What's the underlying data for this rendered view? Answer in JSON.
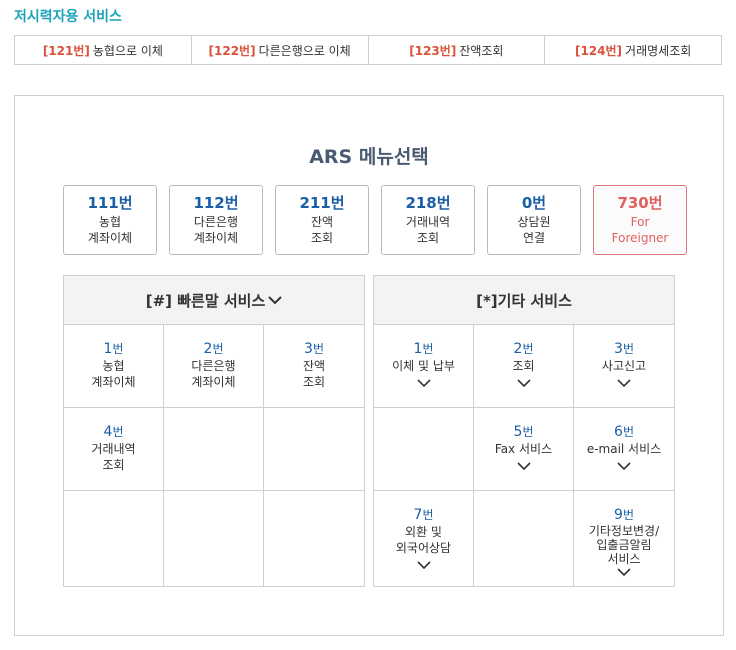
{
  "section_title": "저시력자용 서비스",
  "quick_bar": [
    {
      "num": "[121번]",
      "label": "농협으로 이체"
    },
    {
      "num": "[122번]",
      "label": "다른은행으로 이체"
    },
    {
      "num": "[123번]",
      "label": "잔액조회"
    },
    {
      "num": "[124번]",
      "label": "거래명세조회"
    }
  ],
  "ars_title": "ARS 메뉴선택",
  "menu_buttons": [
    {
      "num": "111번",
      "line1": "농협",
      "line2": "계좌이체"
    },
    {
      "num": "112번",
      "line1": "다른은행",
      "line2": "계좌이체"
    },
    {
      "num": "211번",
      "line1": "잔액",
      "line2": "조회"
    },
    {
      "num": "218번",
      "line1": "거래내역",
      "line2": "조회"
    },
    {
      "num": "0번",
      "line1": "상담원",
      "line2": "연결"
    },
    {
      "num": "730번",
      "line1": "For",
      "line2": "Foreigner"
    }
  ],
  "left_panel": {
    "title": "[#] 빠른말 서비스",
    "cells": [
      {
        "num": "1",
        "unit": "번",
        "line1": "농협",
        "line2": "계좌이체"
      },
      {
        "num": "2",
        "unit": "번",
        "line1": "다른은행",
        "line2": "계좌이체"
      },
      {
        "num": "3",
        "unit": "번",
        "line1": "잔액",
        "line2": "조회"
      },
      {
        "num": "4",
        "unit": "번",
        "line1": "거래내역",
        "line2": "조회"
      }
    ]
  },
  "right_panel": {
    "title": "[*]기타 서비스",
    "cells": [
      {
        "num": "1",
        "unit": "번",
        "line1": "이체 및 납부"
      },
      {
        "num": "2",
        "unit": "번",
        "line1": "조회"
      },
      {
        "num": "3",
        "unit": "번",
        "line1": "사고신고"
      },
      {
        "num": "5",
        "unit": "번",
        "line1": "Fax 서비스"
      },
      {
        "num": "6",
        "unit": "번",
        "line1": "e-mail 서비스"
      },
      {
        "num": "7",
        "unit": "번",
        "line1": "외환 및",
        "line2": "외국어상담"
      },
      {
        "num": "9",
        "unit": "번",
        "line1": "기타정보변경/",
        "line2": "입출금알림",
        "line3": "서비스"
      }
    ]
  }
}
